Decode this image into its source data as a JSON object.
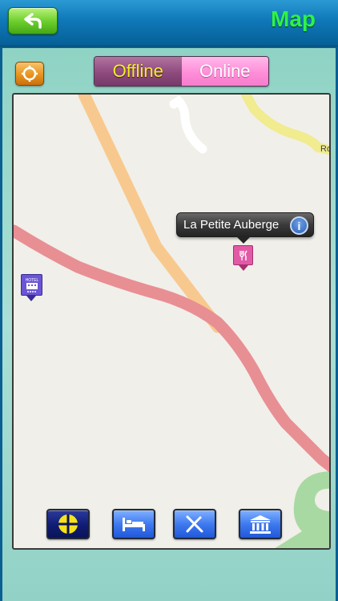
{
  "header": {
    "title": "Map",
    "back_icon": "back-arrow-icon"
  },
  "controls": {
    "locate_icon": "locate-target-icon",
    "segments": [
      "Offline",
      "Online"
    ],
    "selected_segment": "Offline"
  },
  "map": {
    "callout_title": "La Petite Auberge",
    "callout_info_glyph": "i",
    "road_label": "Ro",
    "pins": [
      "restaurant-pin",
      "hotel-pin"
    ],
    "hotel_pin_text": "HOTEL"
  },
  "toolbar": {
    "items": [
      "map-icon",
      "bed-icon",
      "restaurant-icon",
      "museum-icon"
    ]
  },
  "colors": {
    "header_blue": "#0f78b8",
    "title_green": "#2ef24a",
    "offline_segment": "#8e4a7d",
    "online_segment": "#ff8ed8",
    "road_primary": "#e88f94",
    "road_secondary": "#f8c98e",
    "road_tertiary": "#f0ec8f",
    "park_green": "#a9d9a2"
  }
}
